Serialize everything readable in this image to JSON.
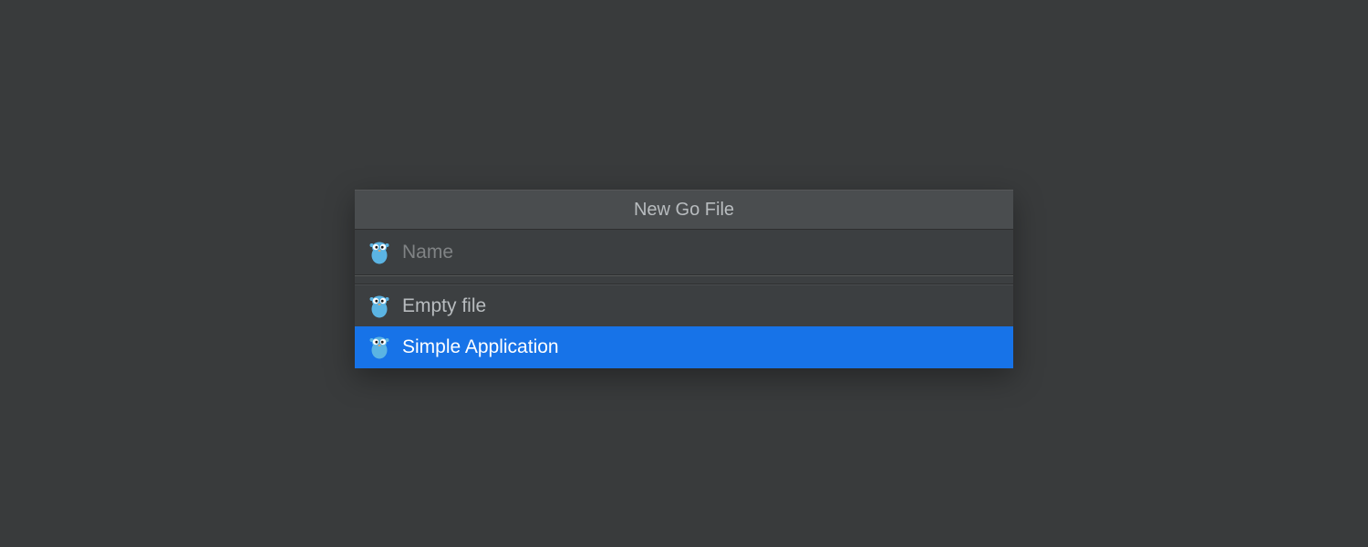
{
  "dialog": {
    "title": "New Go File",
    "name_placeholder": "Name",
    "options": [
      {
        "label": "Empty file",
        "selected": false
      },
      {
        "label": "Simple Application",
        "selected": true
      }
    ],
    "icon": "gopher-icon"
  },
  "colors": {
    "bg": "#393b3c",
    "panel": "#3c3f41",
    "header": "#4a4d4f",
    "selection": "#1773e8",
    "text": "#b8bcbf",
    "placeholder": "#808385"
  }
}
